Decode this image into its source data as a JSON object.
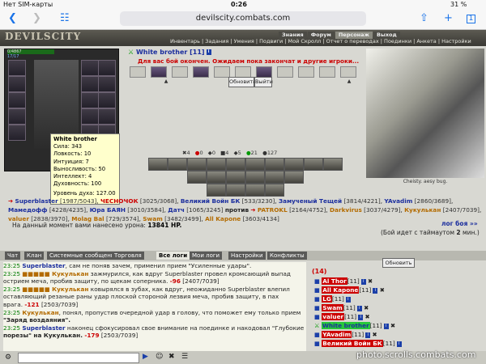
{
  "status_bar": {
    "carrier": "Нет SIM-карты",
    "time": "0:26",
    "battery": "31 %"
  },
  "browser": {
    "url": "devilscity.combats.com",
    "tab_count": "1"
  },
  "game": {
    "logo": "DEVILSCITY",
    "top_nav": [
      "Знания",
      "Форум",
      "Персонаж",
      "Выход"
    ],
    "sub_nav": "Инвентарь | Задания | Умения | Подвиги | Мой Скролл | Отчет о переводах | Поединки | Анкета | Настройки",
    "hp_display": "0/4867",
    "mana_display": "17/17"
  },
  "tooltip": {
    "name": "White brother",
    "stats": [
      "Сила: 343",
      "Ловкость: 10",
      "Интуиция: 7",
      "Выносливость: 50",
      "Интеллект: 4",
      "Духовность: 100"
    ],
    "spirit_level": "Уровень духа: 127.00"
  },
  "battle": {
    "opponent_name": "White brother",
    "opponent_level": "[11]",
    "turn_message": "Для вас бой окончен. Ожидаем пока закончат и другие игроки...",
    "refresh_label": "Обновить",
    "exit_label": "Выйти",
    "counters": [
      "4",
      "0",
      "0",
      "4",
      "5",
      "21",
      "127"
    ]
  },
  "opponent_panel": {
    "caption": "Cheisty. aesy bug."
  },
  "teams": {
    "team_a": [
      {
        "name": "Superblaster",
        "hp": "[1987/5043]"
      },
      {
        "name": "ЧЕСНОЧОК",
        "hp": "[3025/3068]"
      },
      {
        "name": "Великий Войн БК",
        "hp": "[533/3230]"
      },
      {
        "name": "Замученый Тещей",
        "hp": "[3814/4221]"
      },
      {
        "name": "YAvadim",
        "hp": "[2860/3689]"
      },
      {
        "name": "Мамедофф",
        "hp": "[4228/4235]"
      },
      {
        "name": "Юра БАЯН",
        "hp": "[3010/3584]"
      },
      {
        "name": "Датч",
        "hp": "[1065/3245]"
      }
    ],
    "versus": "против",
    "team_b": [
      {
        "name": "PATROKL",
        "hp": "[2164/4752]"
      },
      {
        "name": "Darkvirus",
        "hp": "[3037/4279]"
      },
      {
        "name": "Кукулькан",
        "hp": "[2407/7039]"
      },
      {
        "name": "valuer",
        "hp": "[2838/3970]"
      },
      {
        "name": "Molag Bal",
        "hp": "[729/3574]"
      },
      {
        "name": "Swam",
        "hp": "[3482/3499]"
      },
      {
        "name": "All Kapone",
        "hp": "[3603/4134]"
      }
    ]
  },
  "damage_summary": {
    "prefix": "На данный момент вами нанесено урона:",
    "value": "13841 HP."
  },
  "log_link": "лог боя »»",
  "timeout": {
    "prefix": "(Бой идет с таймаутом",
    "value": "2",
    "suffix": "мин.)"
  },
  "tabs": [
    "Чат",
    "Клан",
    "Системные сообщения",
    "Торговля",
    "Все логи",
    "Мои логи",
    "Настройки",
    "Конфликты"
  ],
  "log": [
    {
      "time": "23:25",
      "actor": "Superblaster",
      "text": ", сам не поняв зачем, применил прием \"Усиленные удары\"."
    },
    {
      "time": "23:25",
      "actor": "Кукулькан",
      "text": " зажмурился, как вдруг Superblaster провел кромсающий выпад",
      "dmg": ""
    },
    {
      "time": "",
      "actor": "",
      "text": "острием меча, пробив защиту, по щекам соперника.",
      "dmg": "-96",
      "hp": "[2407/7039]"
    },
    {
      "time": "23:25",
      "actor": "Кукулькан",
      "text": " ковырялся в зубах, как вдруг, неожиданно Superblaster влепил"
    },
    {
      "time": "",
      "actor": "",
      "text": "оставляющий резаные раны удар плоской стороной лезвия меча, пробив защиту, в пах"
    },
    {
      "time": "",
      "actor": "",
      "text": "врага.",
      "dmg": "-121",
      "hp": "[2503/7039]"
    },
    {
      "time": "23:25",
      "actor": "Кукулькан",
      "text": ", понял, пропустив очередной удар в голову, что поможет ему только прием"
    },
    {
      "time": "",
      "actor": "",
      "text": "\"Заряд воздаяния\"."
    },
    {
      "time": "23:25",
      "actor": "Superblaster",
      "text": " наконец сфокусировал свое внимание на поединке и накодовал \"Глубокие"
    },
    {
      "time": "",
      "actor": "",
      "text": "порезы\" на Кукулькан.",
      "dmg": "-179",
      "hp": "[2503/7039]"
    }
  ],
  "right_list": {
    "refresh_label": "Обновить",
    "count": "(14)",
    "players": [
      {
        "name": "Al Thor",
        "level": "[11]"
      },
      {
        "name": "All Kapone",
        "level": "[11]"
      },
      {
        "name": "LG",
        "level": "[11]"
      },
      {
        "name": "Swam",
        "level": "[11]"
      },
      {
        "name": "valuer",
        "level": "[11]"
      },
      {
        "name": "White brother",
        "level": "[11]"
      },
      {
        "name": "YAvadim",
        "level": "[11]"
      },
      {
        "name": "Великий Войн БК",
        "level": "[11]"
      }
    ]
  },
  "watermark": "photo.scrolls.combats.com"
}
